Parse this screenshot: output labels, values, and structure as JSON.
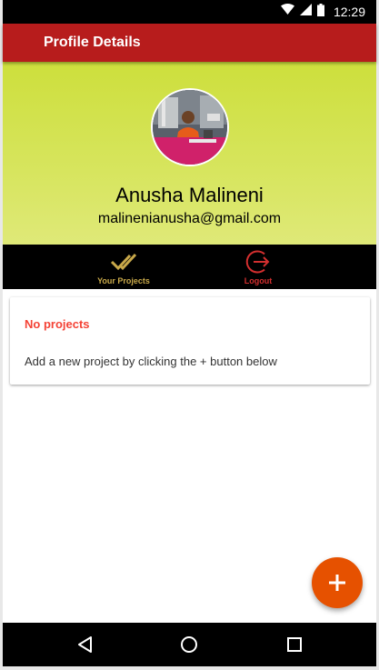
{
  "status_bar": {
    "time": "12:29",
    "icons": [
      "wifi-icon",
      "signal-icon",
      "battery-icon"
    ]
  },
  "app_bar": {
    "title": "Profile Details",
    "color": "#b71c1c"
  },
  "profile": {
    "name": "Anusha Malineni",
    "email": "malinenianusha@gmail.com",
    "avatar_icon": "profile-photo",
    "header_colors": [
      "#cddf3c",
      "#dfe978"
    ]
  },
  "actions": {
    "your_projects": {
      "label": "Your Projects",
      "icon": "double-check-icon",
      "color": "#c9a94a"
    },
    "logout": {
      "label": "Logout",
      "icon": "logout-icon",
      "color": "#d32f2f"
    }
  },
  "projects_card": {
    "title": "No projects",
    "message": "Add a new project by clicking the + button below",
    "title_color": "#f44336"
  },
  "fab": {
    "icon": "plus-icon",
    "color": "#e65100"
  },
  "nav_bar": {
    "icons": [
      "back-icon",
      "home-icon",
      "recents-icon"
    ]
  }
}
